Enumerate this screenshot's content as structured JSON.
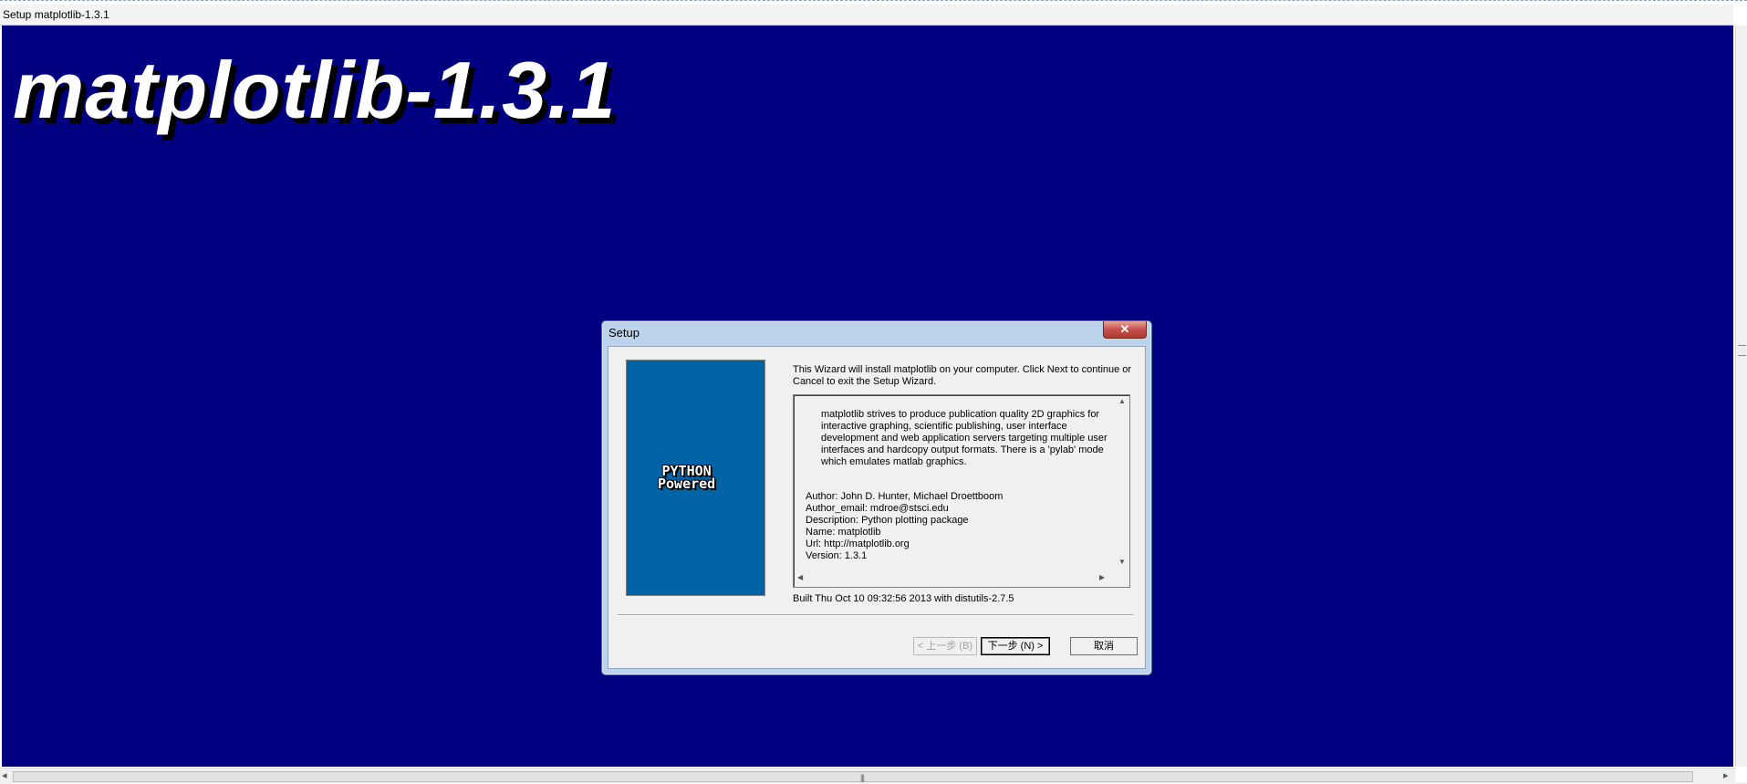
{
  "window": {
    "title": "Setup matplotlib-1.3.1"
  },
  "banner": {
    "title": "matplotlib-1.3.1"
  },
  "dialog": {
    "title": "Setup",
    "close_glyph": "✕",
    "logo": {
      "line1": "PYTHON",
      "line2": "Powered"
    },
    "intro": "This Wizard will install matplotlib on your computer. Click Next to continue or Cancel to exit the Setup Wizard.",
    "description": "matplotlib strives to produce publication quality 2D graphics for interactive graphing, scientific publishing, user interface development and web application servers targeting multiple user interfaces and hardcopy output formats.  There is a 'pylab' mode which emulates matlab graphics.",
    "meta": [
      "Author: John D. Hunter, Michael Droettboom",
      "Author_email: mdroe@stsci.edu",
      "Description: Python plotting package",
      "Name: matplotlib",
      "Url: http://matplotlib.org",
      "Version: 1.3.1"
    ],
    "built": "Built Thu Oct 10 09:32:56 2013 with distutils-2.7.5",
    "buttons": {
      "back": "< 上一步 (B)",
      "next": "下一步 (N) >",
      "cancel": "取消"
    }
  },
  "colors": {
    "background": "#000080",
    "logo_panel": "#0063a6"
  }
}
